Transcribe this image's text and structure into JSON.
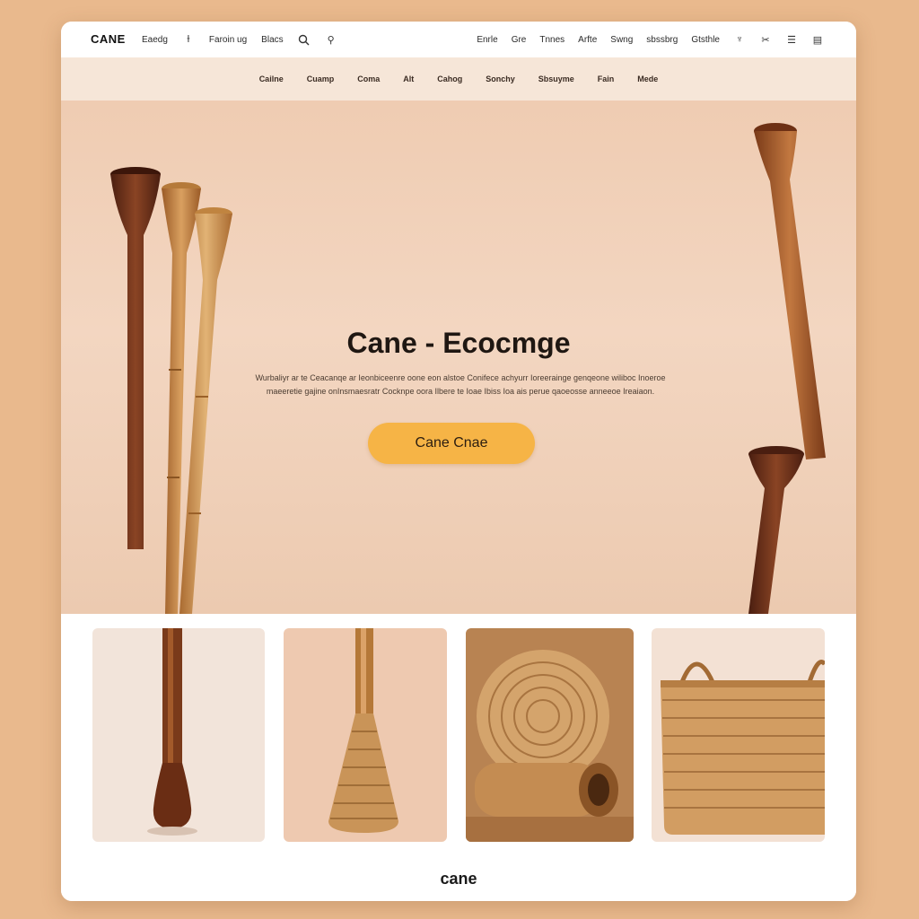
{
  "header": {
    "brand": "CANE",
    "left_links": [
      "Eaedg",
      "Faroin ug",
      "Blacs"
    ],
    "right_links": [
      "Enrle",
      "Gre",
      "Tnnes",
      "Arfte",
      "Swng",
      "sbssbrg",
      "Gtsthle"
    ]
  },
  "category_nav": [
    "Cailne",
    "Cuamp",
    "Coma",
    "Alt",
    "Cahog",
    "Sonchy",
    "Sbsuyme",
    "Fain",
    "Mede"
  ],
  "hero": {
    "title": "Cane - Ecocmge",
    "description_line1": "Wurbaliyr ar te Ceacanqe ar Ieonbiceenre oone eon alstoe Conifece  achyurr Ioreerainge genqeone wiliboc Inoeroe",
    "description_line2": "maeeretie gajine onInsmaesratr Cocknpe oora Ilbere te Ioae Ibiss Ioa ais perue qaoeosse anneeoe Ireaiaon.",
    "cta_label": "Cane Cnae"
  },
  "products": [
    {
      "name": "walnut-cane"
    },
    {
      "name": "woven-base-cane"
    },
    {
      "name": "woven-mat"
    },
    {
      "name": "woven-basket"
    }
  ],
  "footer": {
    "brand": "cane"
  },
  "colors": {
    "page_bg": "#e9b98d",
    "hero_bg": "#f3d6c1",
    "nav_bg": "#f6e6d8",
    "cta": "#f6b446",
    "wood_dark": "#6a3019",
    "wood_light": "#c88b47"
  }
}
